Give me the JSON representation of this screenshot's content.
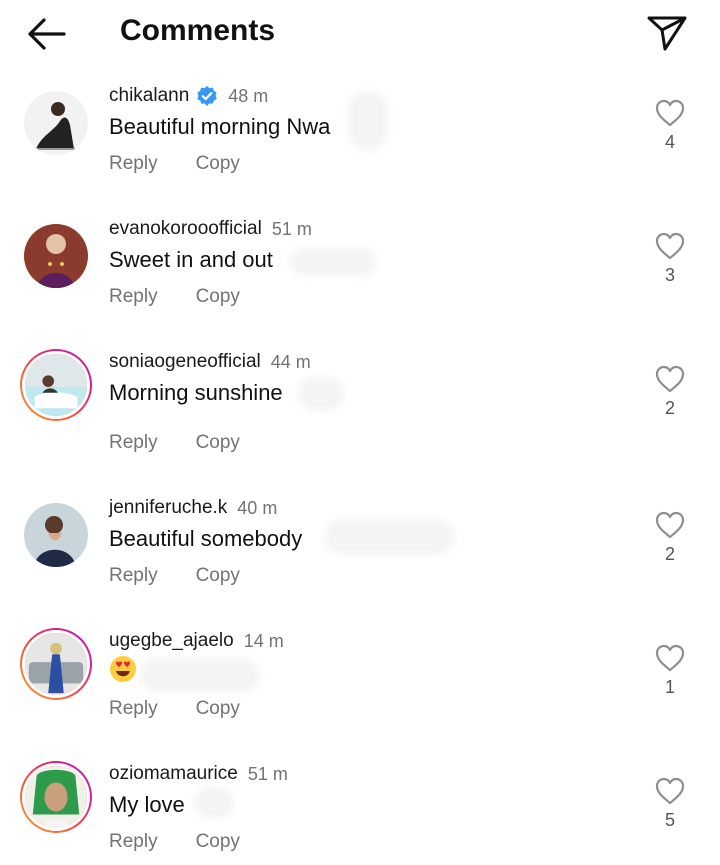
{
  "header": {
    "title": "Comments",
    "back_icon": "arrow-left-icon",
    "share_icon": "paper-plane-icon"
  },
  "actions": {
    "reply_label": "Reply",
    "copy_label": "Copy"
  },
  "colors": {
    "text": "#111111",
    "muted": "#737373",
    "verified": "#3897f0",
    "story_ring_start": "#f9a43a",
    "story_ring_end": "#b225c9"
  },
  "comments": [
    {
      "username": "chikalann",
      "verified": true,
      "time": "48 m",
      "text": "Beautiful morning Nwa",
      "likes": "4",
      "story_ring": false
    },
    {
      "username": "evanokorooofficial",
      "verified": false,
      "time": "51 m",
      "text": "Sweet in and out",
      "likes": "3",
      "story_ring": false
    },
    {
      "username": "soniaogeneofficial",
      "verified": false,
      "time": "44 m",
      "text": "Morning sunshine",
      "likes": "2",
      "story_ring": true
    },
    {
      "username": "jenniferuche.k",
      "verified": false,
      "time": "40 m",
      "text": "Beautiful somebody",
      "likes": "2",
      "story_ring": false
    },
    {
      "username": "ugegbe_ajaelo",
      "verified": false,
      "time": "14 m",
      "text": "",
      "emoji": "heart-eyes-emoji",
      "likes": "1",
      "story_ring": true
    },
    {
      "username": "oziomamaurice",
      "verified": false,
      "time": "51 m",
      "text": "My love",
      "likes": "5",
      "story_ring": true
    }
  ]
}
